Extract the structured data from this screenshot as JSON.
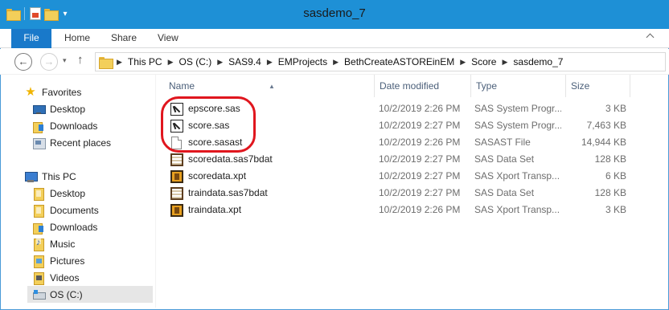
{
  "window": {
    "title": "sasdemo_7"
  },
  "ribbon": {
    "tabs": [
      "File",
      "Home",
      "Share",
      "View"
    ]
  },
  "address": {
    "crumbs": [
      "This PC",
      "OS (C:)",
      "SAS9.4",
      "EMProjects",
      "BethCreateASTOREinEM",
      "Score",
      "sasdemo_7"
    ]
  },
  "sidebar": {
    "favorites": {
      "label": "Favorites",
      "items": [
        "Desktop",
        "Downloads",
        "Recent places"
      ]
    },
    "thispc": {
      "label": "This PC",
      "items": [
        "Desktop",
        "Documents",
        "Downloads",
        "Music",
        "Pictures",
        "Videos",
        "OS (C:)"
      ]
    }
  },
  "columns": {
    "name": "Name",
    "date": "Date modified",
    "type": "Type",
    "size": "Size"
  },
  "files": [
    {
      "name": "epscore.sas",
      "date": "10/2/2019 2:26 PM",
      "type": "SAS System Progr...",
      "size": "3 KB",
      "icon": "sas-program-icon"
    },
    {
      "name": "score.sas",
      "date": "10/2/2019 2:27 PM",
      "type": "SAS System Progr...",
      "size": "7,463 KB",
      "icon": "sas-program-icon"
    },
    {
      "name": "score.sasast",
      "date": "10/2/2019 2:26 PM",
      "type": "SASAST File",
      "size": "14,944 KB",
      "icon": "blank-file-icon"
    },
    {
      "name": "scoredata.sas7bdat",
      "date": "10/2/2019 2:27 PM",
      "type": "SAS Data Set",
      "size": "128 KB",
      "icon": "sas-dataset-icon"
    },
    {
      "name": "scoredata.xpt",
      "date": "10/2/2019 2:27 PM",
      "type": "SAS Xport Transp...",
      "size": "6 KB",
      "icon": "sas-xport-icon"
    },
    {
      "name": "traindata.sas7bdat",
      "date": "10/2/2019 2:27 PM",
      "type": "SAS Data Set",
      "size": "128 KB",
      "icon": "sas-dataset-icon"
    },
    {
      "name": "traindata.xpt",
      "date": "10/2/2019 2:26 PM",
      "type": "SAS Xport Transp...",
      "size": "3 KB",
      "icon": "sas-xport-icon"
    }
  ],
  "colors": {
    "titlebar": "#1e90d6",
    "file_tab": "#1979ca",
    "highlight": "#e0161e",
    "header_text": "#4c607a"
  }
}
